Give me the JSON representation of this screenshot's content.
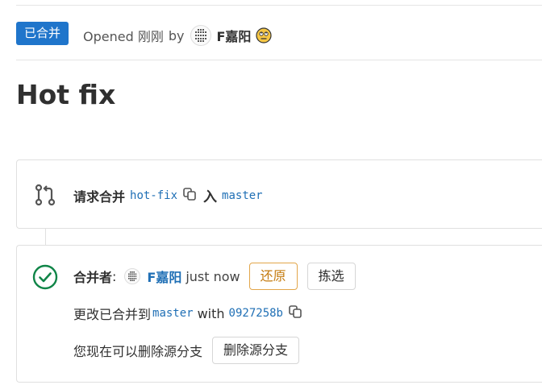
{
  "header": {
    "status_badge": "已合并",
    "opened_text": "Opened 刚刚",
    "by_text": "by",
    "author": "F嘉阳",
    "emoji": "face-with-rolling-eyes-icon"
  },
  "title": "Hot fix",
  "merge_request": {
    "label": "请求合并",
    "source_branch": "hot-fix",
    "into_symbol": "入",
    "target_branch": "master"
  },
  "merged": {
    "label": "合并者",
    "colon": ":",
    "merger": "F嘉阳",
    "time": "just now",
    "revert_label": "还原",
    "cherry_pick_label": "拣选",
    "changes_text": "更改已合并到",
    "target_branch": "master",
    "with_text": "with",
    "commit_sha": "0927258b",
    "delete_hint": "您现在可以删除源分支",
    "delete_button": "删除源分支"
  },
  "colors": {
    "badge_bg": "#1f75cb",
    "link": "#1f6fb5",
    "success": "#108548",
    "revert": "#c47b0f"
  }
}
